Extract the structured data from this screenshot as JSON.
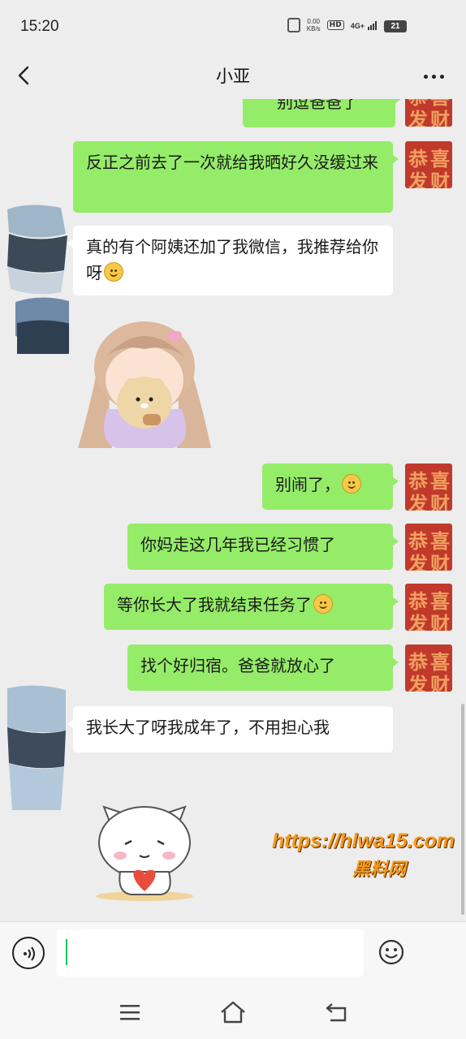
{
  "status_bar": {
    "time": "15:20",
    "net_speed_value": "0.00",
    "net_speed_unit": "KB/s",
    "hd_badge": "HD",
    "sim1": "4G+",
    "sim2": "4G",
    "battery": "21"
  },
  "header": {
    "title": "小亚"
  },
  "messages": [
    {
      "id": "m0",
      "side": "sent",
      "text": "别逗爸爸了"
    },
    {
      "id": "m1",
      "side": "sent",
      "text": "反正之前去了一次就给我晒好久没缓过来"
    },
    {
      "id": "m2",
      "side": "received",
      "text": "真的有个阿姨还加了我微信，我推荐给你呀"
    },
    {
      "id": "m3",
      "side": "received",
      "type": "sticker",
      "sticker": "girl-hugging-bear"
    },
    {
      "id": "m4",
      "side": "sent",
      "text": "别闹了，"
    },
    {
      "id": "m5",
      "side": "sent",
      "text": "你妈走这几年我已经习惯了"
    },
    {
      "id": "m6",
      "side": "sent",
      "text": "等你长大了我就结束任务了"
    },
    {
      "id": "m7",
      "side": "sent",
      "text": "找个好归宿。爸爸就放心了"
    },
    {
      "id": "m8",
      "side": "received",
      "text": "我长大了呀我成年了，不用担心我"
    },
    {
      "id": "m9",
      "side": "received",
      "type": "sticker",
      "sticker": "cat-holding-heart"
    }
  ],
  "avatar_me": {
    "top_left": "恭",
    "top_right": "喜",
    "bottom_left": "发",
    "bottom_right": "财"
  },
  "watermark": {
    "url": "https://hlwa15.com",
    "name": "黑料网"
  },
  "input": {
    "value": "",
    "placeholder": ""
  },
  "colors": {
    "sent_bubble": "#95ec69",
    "received_bubble": "#ffffff",
    "background": "#ededed",
    "watermark": "#f59a1a"
  },
  "icons": {
    "back": "chevron-left-icon",
    "more": "more-dots-icon",
    "voice": "voice-icon",
    "emoji": "emoji-icon",
    "menu": "menu-icon",
    "home": "home-icon",
    "back_nav": "return-icon"
  }
}
